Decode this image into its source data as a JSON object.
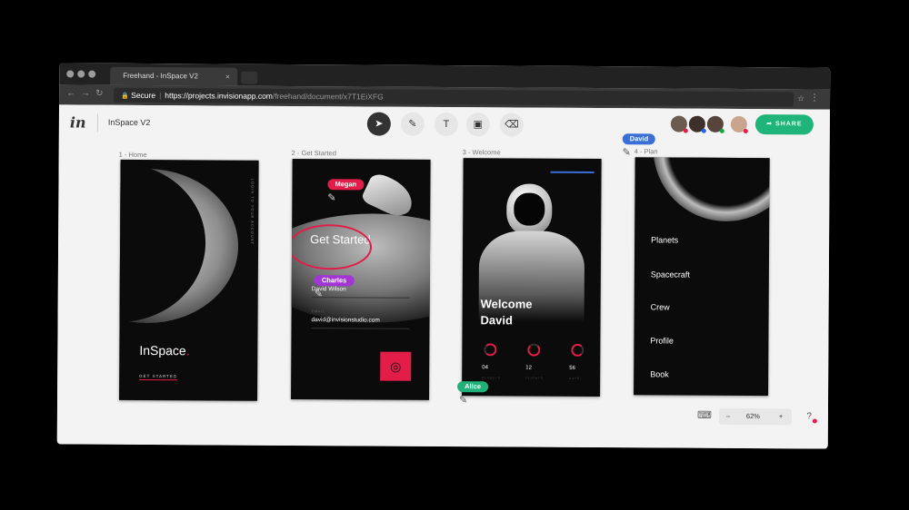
{
  "browser": {
    "tab_title": "Freehand - InSpace V2",
    "tab_close": "×",
    "secure_label": "Secure",
    "url_host": "https://projects.invisionapp.com",
    "url_path": "/freehand/document/x7T1EiXFG",
    "star": "☆",
    "menu": "⋮",
    "back": "←",
    "forward": "→",
    "reload": "↻",
    "lock": "🔒"
  },
  "app": {
    "logo": "in",
    "project_title": "InSpace V2",
    "share_label": "SHARE",
    "tools": [
      {
        "name": "select",
        "glyph": "➤"
      },
      {
        "name": "pencil",
        "glyph": "✎"
      },
      {
        "name": "text",
        "glyph": "T"
      },
      {
        "name": "image",
        "glyph": "▣"
      },
      {
        "name": "eraser",
        "glyph": "⌫"
      }
    ],
    "avatar_dots": [
      "#e11d48",
      "#2563eb",
      "#16a34a",
      "#e11d48"
    ]
  },
  "artboards": [
    {
      "label": "1 - Home",
      "brand": "InSpace",
      "cta": "GET STARTED",
      "vertical_text": "LOGIN TO YOUR ACCOUNT"
    },
    {
      "label": "2 - Get Started",
      "heading": "Get Started",
      "name_value": "David Wilson",
      "email_label": "EMAIL",
      "email_value": "david@invisionstudio.com"
    },
    {
      "label": "3 - Welcome",
      "heading": "Welcome David",
      "stats": [
        "04",
        "12",
        "56"
      ],
      "stat_labels": [
        "PLANETS",
        "FLIGHTS",
        "DAYS"
      ]
    },
    {
      "label": "4 - Plan",
      "menu": [
        "Planets",
        "Spacecraft",
        "Crew",
        "Profile",
        "Book"
      ]
    }
  ],
  "collaborators": [
    {
      "name": "Megan",
      "color": "#e11d48"
    },
    {
      "name": "Charles",
      "color": "#a335d4"
    },
    {
      "name": "Alice",
      "color": "#22b07a"
    },
    {
      "name": "David",
      "color": "#3b6fd8"
    }
  ],
  "zoom": {
    "minus": "–",
    "level": "62%",
    "plus": "+"
  },
  "help": "?"
}
